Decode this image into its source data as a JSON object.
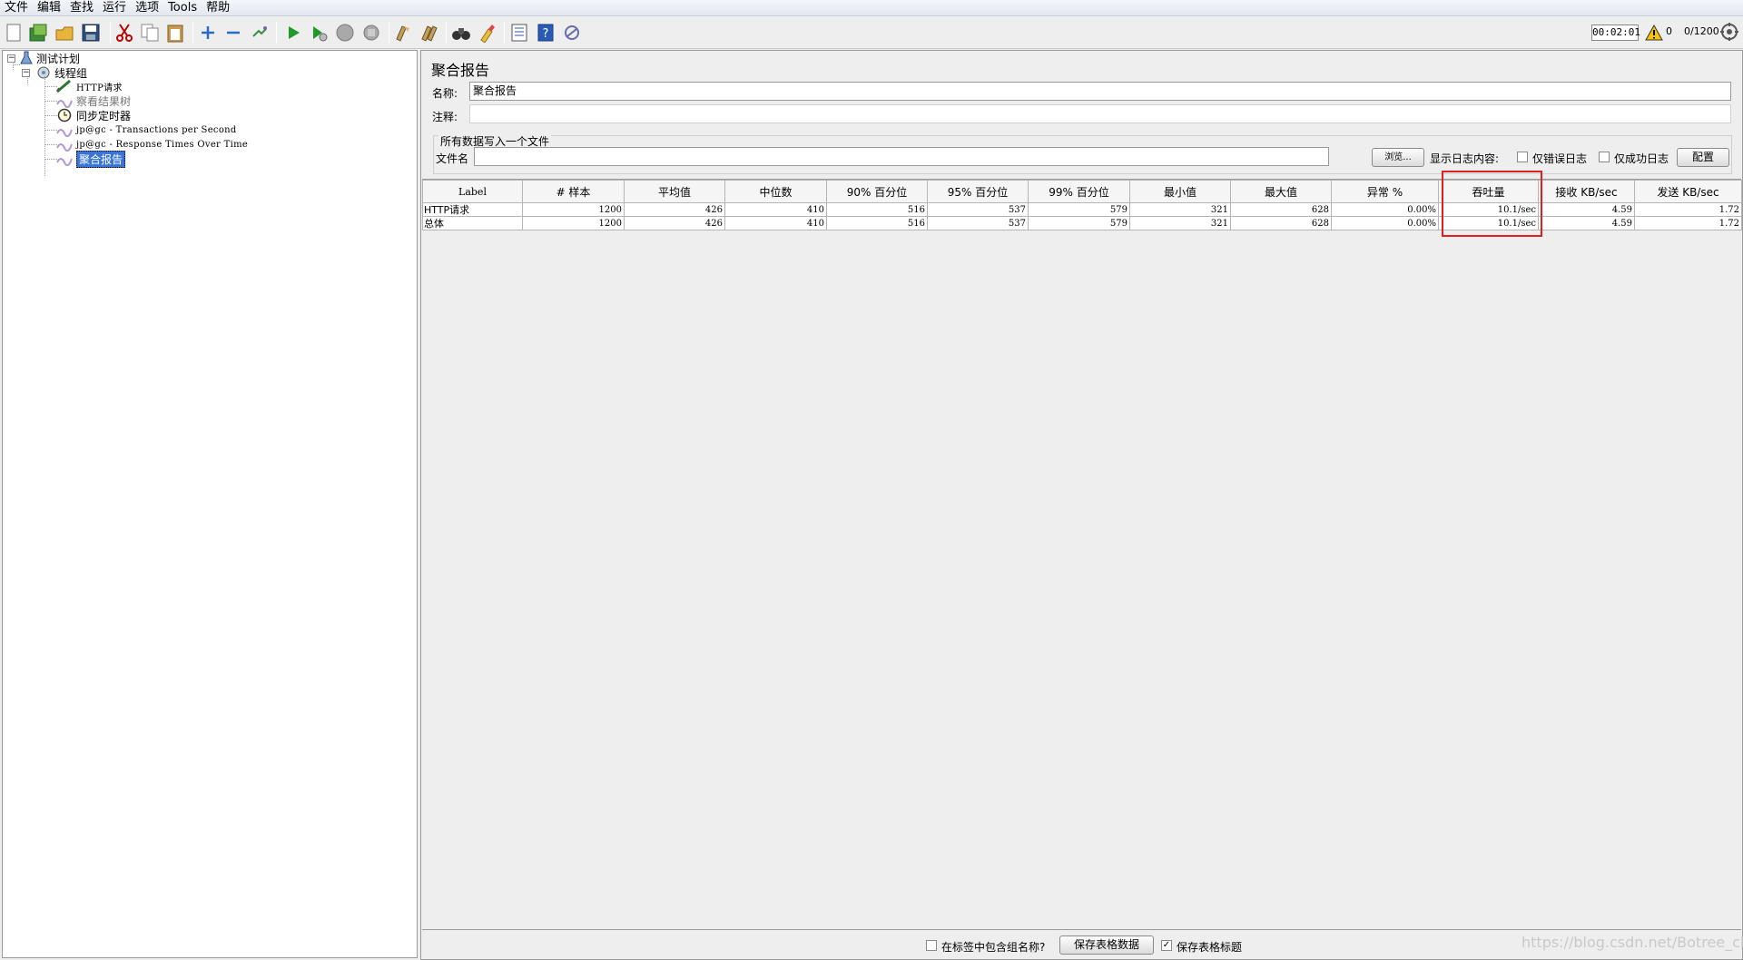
{
  "menu": [
    "文件",
    "编辑",
    "查找",
    "运行",
    "选项",
    "Tools",
    "帮助"
  ],
  "toolbar": {
    "timer": "00:02:01",
    "warning_count": "0",
    "thread_count": "0/1200"
  },
  "tree": {
    "test_plan": "测试计划",
    "thread_group": "线程组",
    "children": [
      {
        "label": "HTTP请求"
      },
      {
        "label": "察看结果树"
      },
      {
        "label": "同步定时器"
      },
      {
        "label": "jp@gc - Transactions per Second"
      },
      {
        "label": "jp@gc - Response Times Over Time"
      },
      {
        "label": "聚合报告"
      }
    ]
  },
  "panel": {
    "title": "聚合报告",
    "name_label": "名称:",
    "name_value": "聚合报告",
    "comment_label": "注释:",
    "comment_value": "",
    "file_group_label": "所有数据写入一个文件",
    "filename_label": "文件名",
    "filename_value": "",
    "browse_button": "浏览...",
    "log_display_label": "显示日志内容:",
    "errors_only_label": "仅错误日志",
    "success_only_label": "仅成功日志",
    "configure_button": "配置"
  },
  "table": {
    "columns": [
      "Label",
      "# 样本",
      "平均值",
      "中位数",
      "90% 百分位",
      "95% 百分位",
      "99% 百分位",
      "最小值",
      "最大值",
      "异常 %",
      "吞吐量",
      "接收 KB/sec",
      "发送 KB/sec"
    ],
    "rows": [
      [
        "HTTP请求",
        "1200",
        "426",
        "410",
        "516",
        "537",
        "579",
        "321",
        "628",
        "0.00%",
        "10.1/sec",
        "4.59",
        "1.72"
      ],
      [
        "总体",
        "1200",
        "426",
        "410",
        "516",
        "537",
        "579",
        "321",
        "628",
        "0.00%",
        "10.1/sec",
        "4.59",
        "1.72"
      ]
    ]
  },
  "footer": {
    "include_group_label": "在标签中包含组名称?",
    "save_table_button": "保存表格数据",
    "save_header_label": "保存表格标题",
    "save_header_checked": true
  },
  "watermark": "https://blog.csdn.net/Botree_chan"
}
